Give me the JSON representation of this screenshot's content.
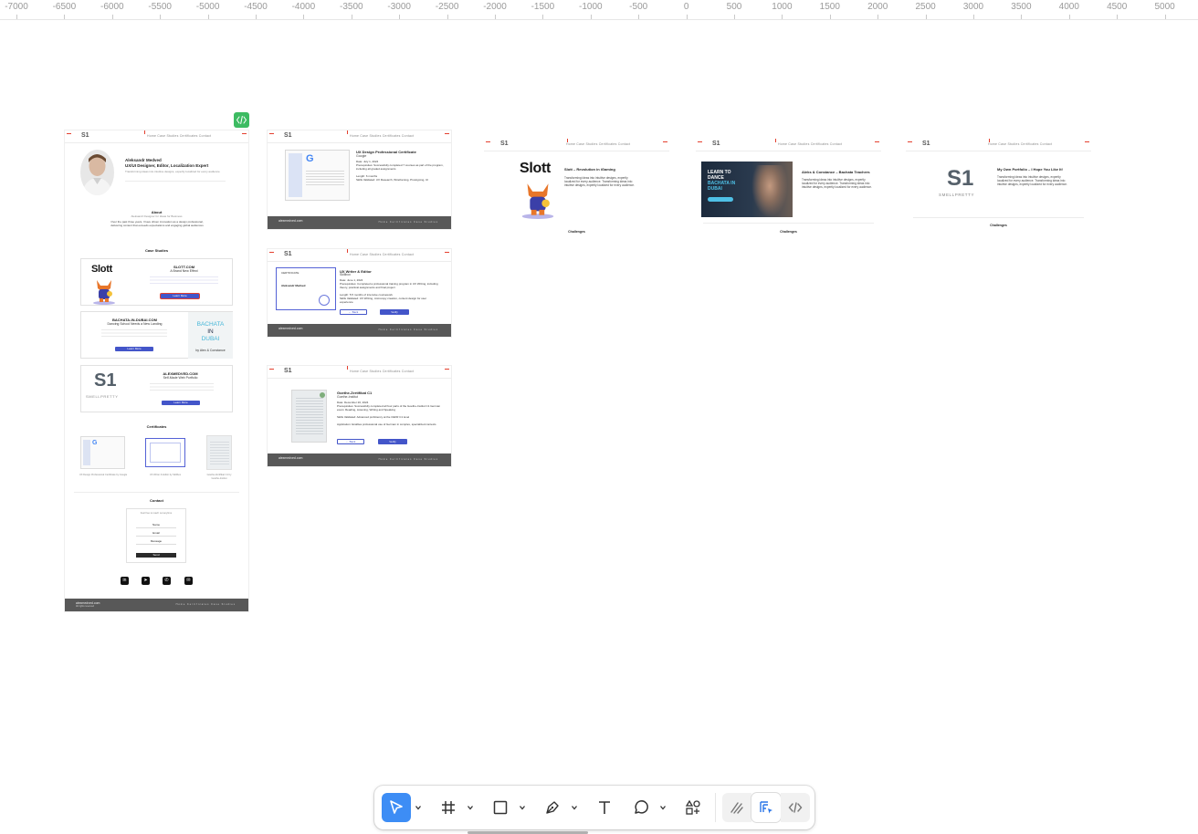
{
  "ruler": {
    "ticks": [
      "-7000",
      "-6500",
      "-6000",
      "-5500",
      "-5000",
      "-4500",
      "-4000",
      "-3500",
      "-3000",
      "-2500",
      "-2000",
      "-1500",
      "-1000",
      "-500",
      "0",
      "500",
      "1000",
      "1500",
      "2000",
      "2500",
      "3000",
      "3500",
      "4000",
      "4500",
      "5000"
    ]
  },
  "home_frame": {
    "nav_logo": "S1",
    "nav_links": "Home   Case Studies   Certificates   Contact",
    "profile_name": "Aleksandr Medved",
    "profile_role": "UX/UI Designer, Editor, Localization Expert",
    "profile_tagline": "Transforming ideas into intuitive designs, expertly localized for every audience",
    "about_title": "About",
    "about_sub": "Aleksandr Designer for Ideas for Business",
    "about_text": "Over the past three years, I have driven innovation as a design professional, delivering content that exceeds expectations and engaging global audiences",
    "case_studies_title": "Case Studies",
    "case1_title": "SLOTT.COM",
    "case1_sub": "A Brand New Effect",
    "case1_brand": "Slott",
    "case1_btn": "Learn More",
    "case2_title": "BACHATA-IN-DUBAI.COM",
    "case2_sub": "Dancing School Needs a New Landing",
    "case2_btn": "Learn More",
    "case2_art_l1": "BACHATA",
    "case2_art_l2": "IN",
    "case2_art_l3": "DUBAI",
    "case2_art_by": "by Alex & Constance",
    "case3_title": "ALEXMEDVED.COM",
    "case3_sub": "Self-Made Web Portfolio",
    "case3_btn": "Learn More",
    "case3_logo": "S1",
    "case3_logo_word": "SMELLPRETTY",
    "certificates_title": "Certificates",
    "cert1_caption": "UX Design Professional Certificate by Google",
    "cert2_caption": "UX Writer & Editor by Skillbox",
    "cert3_caption": "Goethe-Zertifikat C1 by Goethe-Institut",
    "contact_title": "Contact",
    "contact_sub": "Feel free to reach out anytime",
    "contact_name": "Name",
    "contact_email": "Email",
    "contact_message": "Message",
    "contact_send": "Send",
    "footer_site": "alexmedved.com",
    "footer_sub": "All rights reserved",
    "footer_links": "Home   Certificates   Case Studies"
  },
  "cert_frames": [
    {
      "title": "UX Design Professional Certificate",
      "issuer": "Google",
      "line1": "Date: July 1, 2024",
      "line2": "Prerequisites: Successfully completed 7 courses as part of the program, including all graded assignments",
      "line3": "Length: 6 months",
      "line4": "Skills Validated: UX Research, Wireframing, Prototyping, UI",
      "g_letter": "G",
      "footer_site": "alexmedved.com",
      "footer_links": "Home   Certificates   Case Studies"
    },
    {
      "title": "UX Writer & Editor",
      "issuer": "Skillbox",
      "line1": "Date: June 1, 2024",
      "line2": "Prerequisites: Completed a professional training program in UX Writing, including theory, practical assignments and final project",
      "line3": "Length: 5.5 months of intensive coursework",
      "line4": "Skills Validated: UX Writing, microcopy creation, content design for user experience",
      "back": "← Back",
      "verify": "Verify",
      "cert_name": "Aleksandr Medved",
      "cert_label": "CERTIFICATE",
      "footer_site": "alexmedved.com",
      "footer_links": "Home   Certificates   Case Studies"
    },
    {
      "title": "Goethe-Zertifikat C1",
      "issuer": "Goethe-Institut",
      "line1": "Date: December 20, 2024",
      "line2": "Prerequisites: Successfully completed all four parts of the Goethe-Institut C1 German exam: Reading, Listening, Writing and Speaking",
      "line3": "Skills Validated: Advanced proficiency at the CEFR C1 level",
      "line4": "Application: Enables professional use of German in complex, specialized contexts",
      "back": "← Back",
      "verify": "Verify",
      "footer_site": "alexmedved.com",
      "footer_links": "Home   Certificates   Case Studies"
    }
  ],
  "case_frames": [
    {
      "brand": "Slott",
      "heading": "Slott – Revolution in iGaming",
      "text": "Transforming ideas into intuitive designs, expertly localized for every audience. Transforming ideas into intuitive designs, expertly localized for every audience.",
      "challenges": "Challenges"
    },
    {
      "art_l1": "LEARN TO",
      "art_l2": "DANCE",
      "art_l3": "BACHATA IN",
      "art_l4": "DUBAI",
      "heading": "Aleks & Constance – Bachata Teachers",
      "text": "Transforming ideas into intuitive designs, expertly localized for every audience. Transforming ideas into intuitive designs, expertly localized for every audience.",
      "challenges": "Challenges"
    },
    {
      "logo": "S1",
      "logo_word": "SMELLPRETTY",
      "heading": "My Own Portfolio – I Hope You Like It!",
      "text": "Transforming ideas into intuitive designs, expertly localized for every audience. Transforming ideas into intuitive designs, expertly localized for every audience.",
      "challenges": "Challenges"
    }
  ],
  "toolbar": {
    "tools": [
      "move-tool",
      "frame-tool",
      "shape-tool",
      "pen-tool",
      "text-tool",
      "comment-tool",
      "actions-tool",
      "draw-mode",
      "design-mode",
      "dev-mode"
    ]
  },
  "colors": {
    "accent": "#3d8df5",
    "button_blue": "#4355c9",
    "footer_gray": "#585858",
    "badge_green": "#3dbb62",
    "ruler_red": "#e4402f"
  }
}
